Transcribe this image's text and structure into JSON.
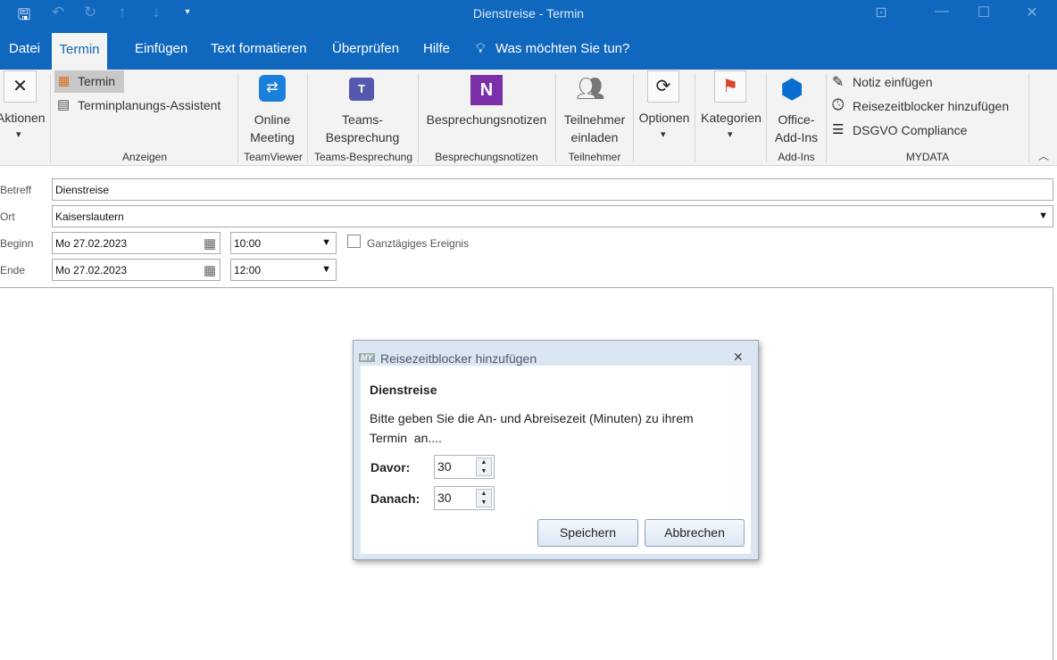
{
  "window": {
    "title": "Dienstreise  -  Termin"
  },
  "quick_access": [
    "save-icon",
    "undo-icon",
    "redo-icon",
    "up-icon",
    "down-icon",
    "customize-icon"
  ],
  "tabs": [
    "Datei",
    "Termin",
    "Einfügen",
    "Text formatieren",
    "Überprüfen",
    "Hilfe"
  ],
  "active_tab": "Termin",
  "tell_me": "Was möchten Sie tun?",
  "ribbon": {
    "aktionen": "Aktionen",
    "anzeigen": {
      "termin": "Termin",
      "assistent": "Terminplanungs-Assistent",
      "label": "Anzeigen"
    },
    "teamviewer": {
      "line1": "Online",
      "line2": "Meeting",
      "label": "TeamViewer"
    },
    "teams": {
      "line1": "Teams-",
      "line2": "Besprechung",
      "label": "Teams-Besprechung"
    },
    "notes": {
      "button": "Besprechungsnotizen",
      "label": "Besprechungsnotizen"
    },
    "attendees": {
      "line1": "Teilnehmer",
      "line2": "einladen",
      "label": "Teilnehmer"
    },
    "optionen": "Optionen",
    "kategorien": "Kategorien",
    "addins": {
      "line1": "Office-",
      "line2": "Add-Ins",
      "label": "Add-Ins"
    },
    "mydata": {
      "notiz": "Notiz einfügen",
      "reise": "Reisezeitblocker hinzufügen",
      "dsgvo": "DSGVO Compliance",
      "label": "MYDATA"
    }
  },
  "form": {
    "betreff_label": "Betreff",
    "betreff": "Dienstreise",
    "ort_label": "Ort",
    "ort": "Kaiserslautern",
    "beginn_label": "Beginn",
    "beginn_date": "Mo 27.02.2023",
    "beginn_time": "10:00",
    "ende_label": "Ende",
    "ende_date": "Mo 27.02.2023",
    "ende_time": "12:00",
    "allday_label": "Ganztägiges Ereignis",
    "allday": false
  },
  "dialog": {
    "title": "Reisezeitblocker hinzufügen",
    "logo": "MY",
    "heading": "Dienstreise",
    "text1": "Bitte geben Sie die An- und Abreisezeit (Minuten) zu ihrem",
    "text2": "Termin  an....",
    "davor_label": "Davor:",
    "davor": "30",
    "danach_label": "Danach:",
    "danach": "30",
    "save": "Speichern",
    "cancel": "Abbrechen"
  }
}
